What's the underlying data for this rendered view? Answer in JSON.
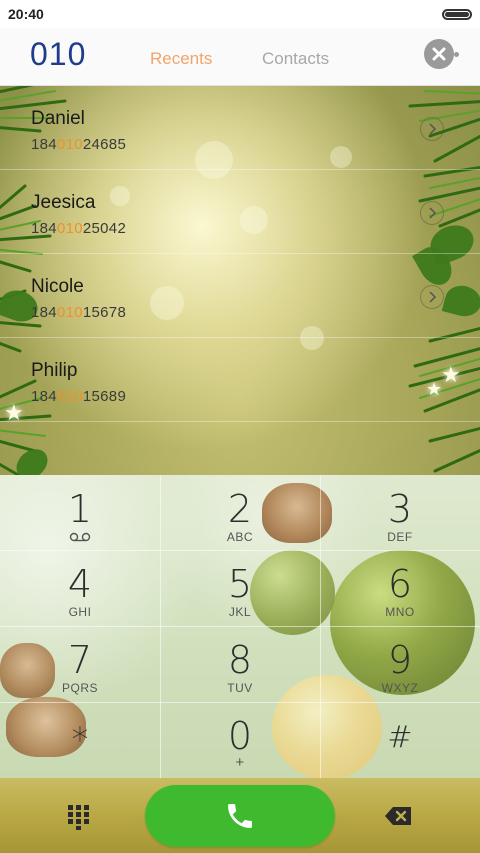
{
  "status_bar": {
    "time": "20:40"
  },
  "header": {
    "dialed_number": "010",
    "tabs": [
      {
        "label": "Recents",
        "active": true
      },
      {
        "label": "Contacts",
        "active": false
      }
    ],
    "clear_icon": "close-circle-icon"
  },
  "contacts": [
    {
      "name": "Daniel",
      "number_prefix": "184",
      "number_match": "010",
      "number_suffix": "24685"
    },
    {
      "name": "Jeesica",
      "number_prefix": "184",
      "number_match": "010",
      "number_suffix": "25042"
    },
    {
      "name": "Nicole",
      "number_prefix": "184",
      "number_match": "010",
      "number_suffix": "15678"
    },
    {
      "name": "Philip",
      "number_prefix": "184",
      "number_match": "010",
      "number_suffix": "15689"
    }
  ],
  "keypad": {
    "keys": [
      {
        "digit": "1",
        "letters": ""
      },
      {
        "digit": "2",
        "letters": "ABC"
      },
      {
        "digit": "3",
        "letters": "DEF"
      },
      {
        "digit": "4",
        "letters": "GHI"
      },
      {
        "digit": "5",
        "letters": "JKL"
      },
      {
        "digit": "6",
        "letters": "MNO"
      },
      {
        "digit": "7",
        "letters": "PQRS"
      },
      {
        "digit": "8",
        "letters": "TUV"
      },
      {
        "digit": "9",
        "letters": "WXYZ"
      },
      {
        "digit": "*",
        "letters": ""
      },
      {
        "digit": "0",
        "letters": "+"
      },
      {
        "digit": "#",
        "letters": ""
      }
    ]
  },
  "action_bar": {
    "dialpad_icon": "dialpad-icon",
    "call_icon": "phone-icon",
    "backspace_icon": "backspace-icon"
  },
  "colors": {
    "accent_blue": "#1e3c8c",
    "match_orange": "#f0912a",
    "tab_active": "#f2a46b",
    "call_green": "#3fba2f"
  }
}
